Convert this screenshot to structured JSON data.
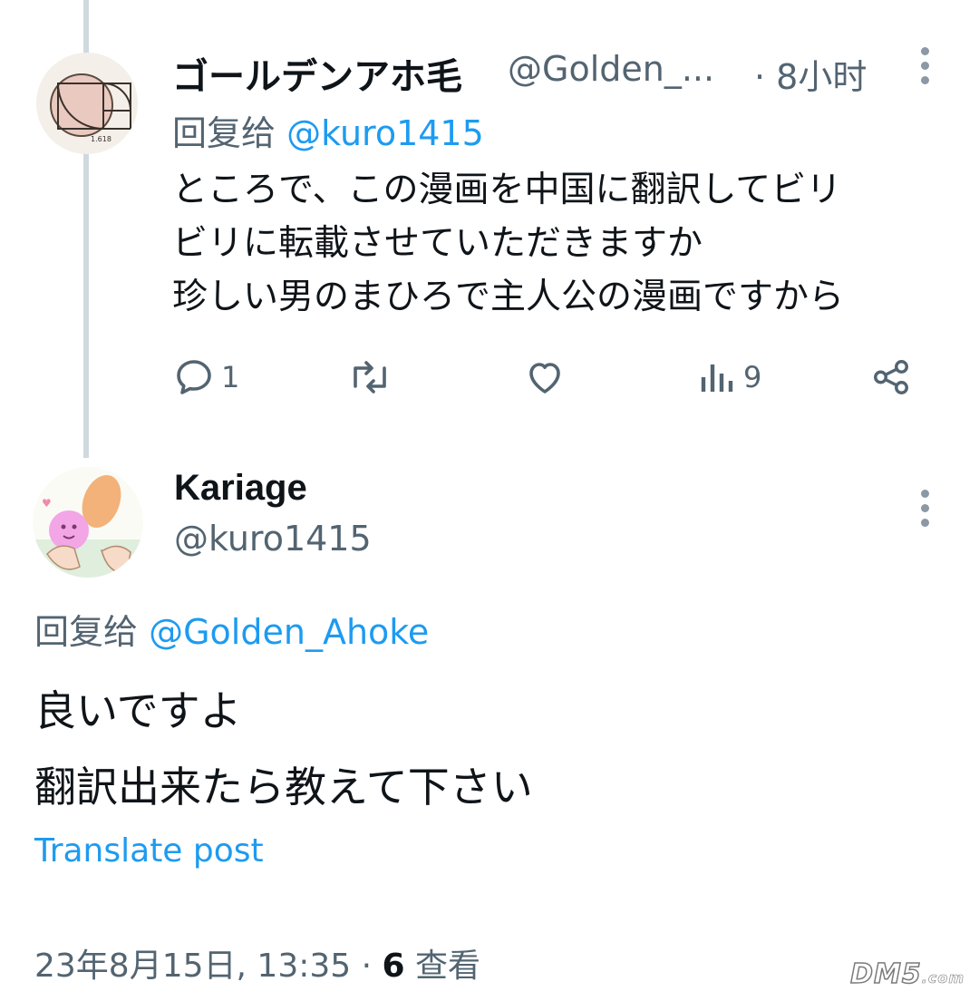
{
  "tweet1": {
    "display_name": "ゴールデンアホ毛",
    "handle": "@Golden_...",
    "time": "· 8小时",
    "reply_prefix": "回复给",
    "reply_to": "@kuro1415",
    "lines": [
      "ところで、この漫画を中国に翻訳してビリ",
      "ビリに転載させていただきますか",
      "珍しい男のまひろで主人公の漫画ですから"
    ],
    "actions": {
      "reply_count": "1",
      "views_count": "9"
    }
  },
  "tweet2": {
    "display_name": "Kariage",
    "handle": "@kuro1415",
    "reply_prefix": "回复给",
    "reply_to": "@Golden_Ahoke",
    "lines": [
      "良いですよ",
      "翻訳出来たら教えて下さい"
    ],
    "translate_label": "Translate post",
    "timestamp": "23年8月15日, 13:35 · ",
    "views_count": "6",
    "views_label": "查看"
  },
  "watermark": {
    "text": "DM5",
    "suffix": ".com"
  },
  "colors": {
    "link": "#1d9bf0",
    "muted": "#536471",
    "text": "#0f1419"
  }
}
